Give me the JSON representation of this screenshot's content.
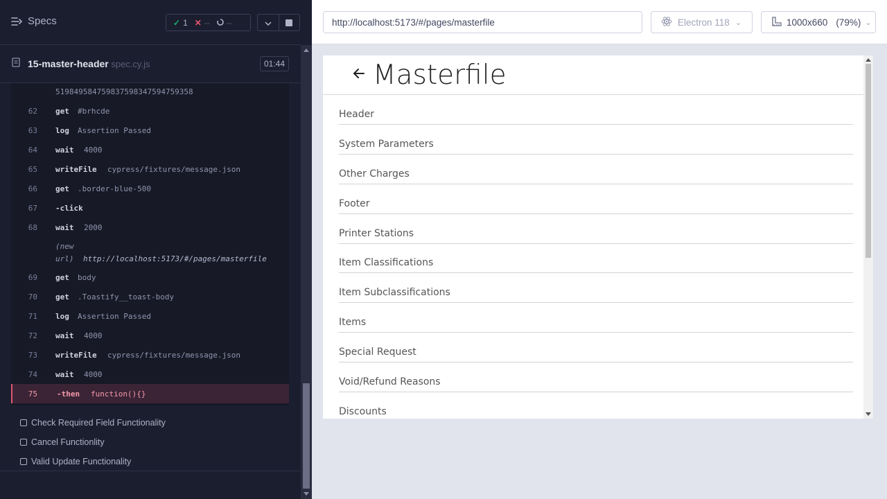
{
  "reporter": {
    "specs_label": "Specs",
    "stats": {
      "passed": "1",
      "failed": "--",
      "pending": "--"
    },
    "spec": {
      "name": "15-master-header",
      "ext": " spec.cy.js",
      "duration": "01:44"
    },
    "long_value": "519849584759837598347594759358",
    "commands": [
      {
        "num": "62",
        "name": "get",
        "msg": "#brhcde"
      },
      {
        "num": "63",
        "name": "log",
        "msg": "Assertion Passed"
      },
      {
        "num": "64",
        "name": "wait",
        "msg": "4000"
      },
      {
        "num": "65",
        "name": "writeFile",
        "msg": "cypress/fixtures/message.json"
      },
      {
        "num": "66",
        "name": "get",
        "msg": ".border-blue-500"
      },
      {
        "num": "67",
        "name": "-click",
        "msg": ""
      },
      {
        "num": "68",
        "name": "wait",
        "msg": "2000"
      },
      {
        "num": "69",
        "name": "get",
        "msg": "body"
      },
      {
        "num": "70",
        "name": "get",
        "msg": ".Toastify__toast-body"
      },
      {
        "num": "71",
        "name": "log",
        "msg": "Assertion Passed"
      },
      {
        "num": "72",
        "name": "wait",
        "msg": "4000"
      },
      {
        "num": "73",
        "name": "writeFile",
        "msg": "cypress/fixtures/message.json"
      },
      {
        "num": "74",
        "name": "wait",
        "msg": "4000"
      },
      {
        "num": "75",
        "name": "-then",
        "msg": "function(){}"
      }
    ],
    "new_url": {
      "label_a": "(new",
      "label_b": "url)",
      "url": "http://localhost:5173/#/pages/masterfile"
    },
    "tests": [
      "Check Required Field Functionality",
      "Cancel Functionlity",
      "Valid Update Functionality"
    ]
  },
  "aut": {
    "url": "http://localhost:5173/#/pages/masterfile",
    "browser": "Electron 118",
    "viewport": "1000x660",
    "zoom": "(79%)",
    "page_title": "Masterfile",
    "menu": [
      "Header",
      "System Parameters",
      "Other Charges",
      "Footer",
      "Printer Stations",
      "Item Classifications",
      "Item Subclassifications",
      "Items",
      "Special Request",
      "Void/Refund Reasons",
      "Discounts"
    ]
  },
  "colors": {
    "pass": "#1fa971",
    "fail": "#e45770",
    "reporter_bg": "#1b1e2e",
    "aut_bg": "#e1e3ed"
  }
}
